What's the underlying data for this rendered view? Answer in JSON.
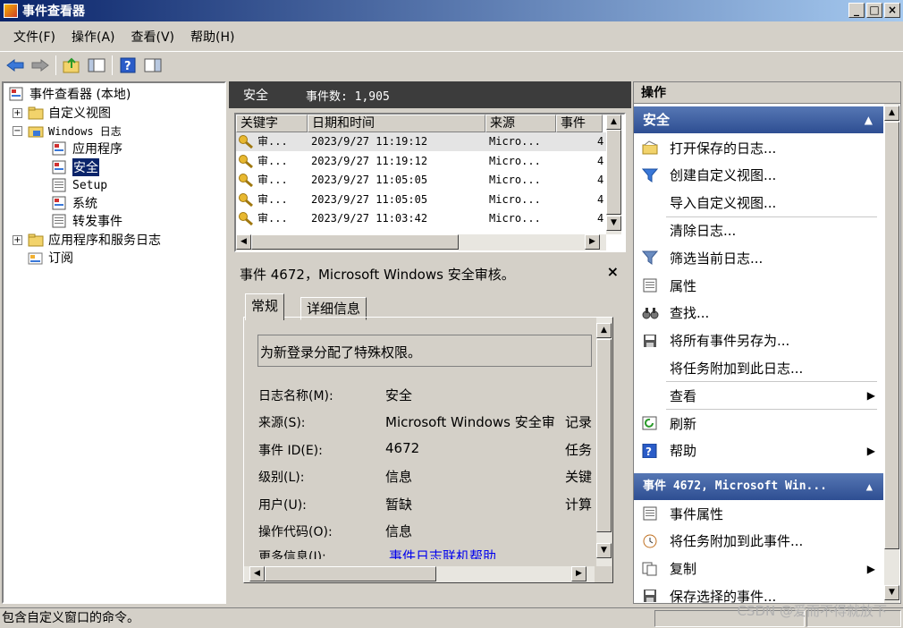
{
  "window": {
    "title": "事件查看器",
    "min": "_",
    "max": "□",
    "close": "×"
  },
  "menu": [
    "文件(F)",
    "操作(A)",
    "查看(V)",
    "帮助(H)"
  ],
  "tree": {
    "root": "事件查看器 (本地)",
    "custom_views": "自定义视图",
    "windows_logs": "Windows 日志",
    "application": "应用程序",
    "security": "安全",
    "setup": "Setup",
    "system": "系统",
    "forwarded": "转发事件",
    "app_service_logs": "应用程序和服务日志",
    "subscriptions": "订阅"
  },
  "list": {
    "title": "安全",
    "count": "事件数: 1,905",
    "columns": [
      "关键字",
      "日期和时间",
      "来源",
      "事件"
    ],
    "rows": [
      {
        "keyword": "审...",
        "datetime": "2023/9/27 11:19:12",
        "source": "Micro...",
        "id": "4"
      },
      {
        "keyword": "审...",
        "datetime": "2023/9/27 11:19:12",
        "source": "Micro...",
        "id": "4"
      },
      {
        "keyword": "审...",
        "datetime": "2023/9/27 11:05:05",
        "source": "Micro...",
        "id": "4"
      },
      {
        "keyword": "审...",
        "datetime": "2023/9/27 11:05:05",
        "source": "Micro...",
        "id": "4"
      },
      {
        "keyword": "审...",
        "datetime": "2023/9/27 11:03:42",
        "source": "Micro...",
        "id": "4"
      }
    ]
  },
  "detail": {
    "title": "事件 4672，Microsoft Windows 安全审核。",
    "close": "×",
    "tabs": [
      "常规",
      "详细信息"
    ],
    "message": "为新登录分配了特殊权限。",
    "fields": {
      "log_name_label": "日志名称(M):",
      "log_name": "安全",
      "source_label": "来源(S):",
      "source": "Microsoft Windows 安全审",
      "source_side": "记录",
      "event_id_label": "事件 ID(E):",
      "event_id": "4672",
      "event_id_side": "任务",
      "level_label": "级别(L):",
      "level": "信息",
      "level_side": "关键",
      "user_label": "用户(U):",
      "user": "暂缺",
      "user_side": "计算",
      "opcode_label": "操作代码(O):",
      "opcode": "信息",
      "more_label": "更多信息(I):",
      "more_link": "事件日志联机帮助"
    }
  },
  "actions": {
    "title": "操作",
    "section1": "安全",
    "items1": [
      "打开保存的日志...",
      "创建自定义视图...",
      "导入自定义视图...",
      "清除日志...",
      "筛选当前日志...",
      "属性",
      "查找...",
      "将所有事件另存为...",
      "将任务附加到此日志...",
      "查看",
      "刷新",
      "帮助"
    ],
    "section2": "事件 4672, Microsoft Win...",
    "items2": [
      "事件属性",
      "将任务附加到此事件...",
      "复制",
      "保存选择的事件..."
    ]
  },
  "status": "包含自定义窗口的命令。",
  "watermark": "CSDN @爱而不得就放下"
}
